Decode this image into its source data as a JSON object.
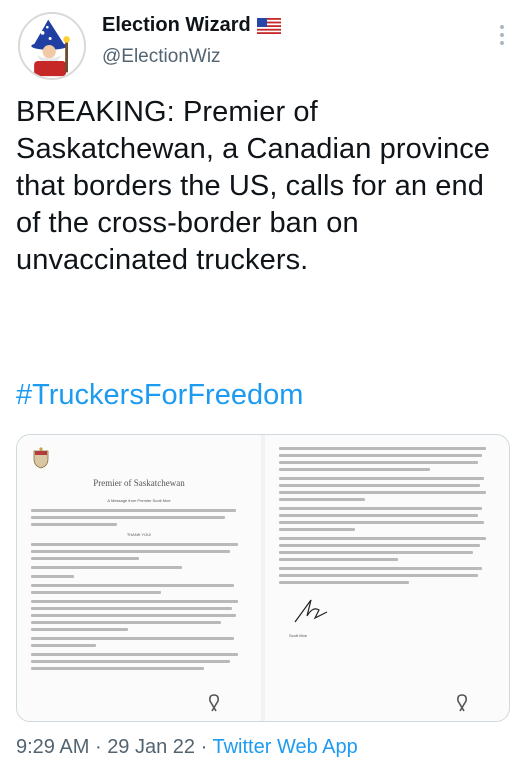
{
  "author": {
    "display_name": "Election Wizard",
    "handle": "@ElectionWiz",
    "flag_icon": "us-flag-icon"
  },
  "tweet": {
    "text": "BREAKING: Premier of Saskatchewan, a Canadian province that borders the US, calls for an end of the cross-border ban on unvaccinated truckers.",
    "hashtag": "#TruckersForFreedom"
  },
  "media": {
    "page1_title": "Premier of Saskatchewan",
    "page1_heading": "A Message from Premier Scott Moe",
    "page1_thanks": "THANK YOU!",
    "page2_signer": "Scott Moe"
  },
  "footer": {
    "time": "9:29 AM",
    "sep1": "·",
    "date": "29 Jan 22",
    "sep2": "·",
    "source": "Twitter Web App"
  },
  "colors": {
    "accent": "#1d9bf0",
    "text": "#0f1419",
    "muted": "#536471"
  }
}
